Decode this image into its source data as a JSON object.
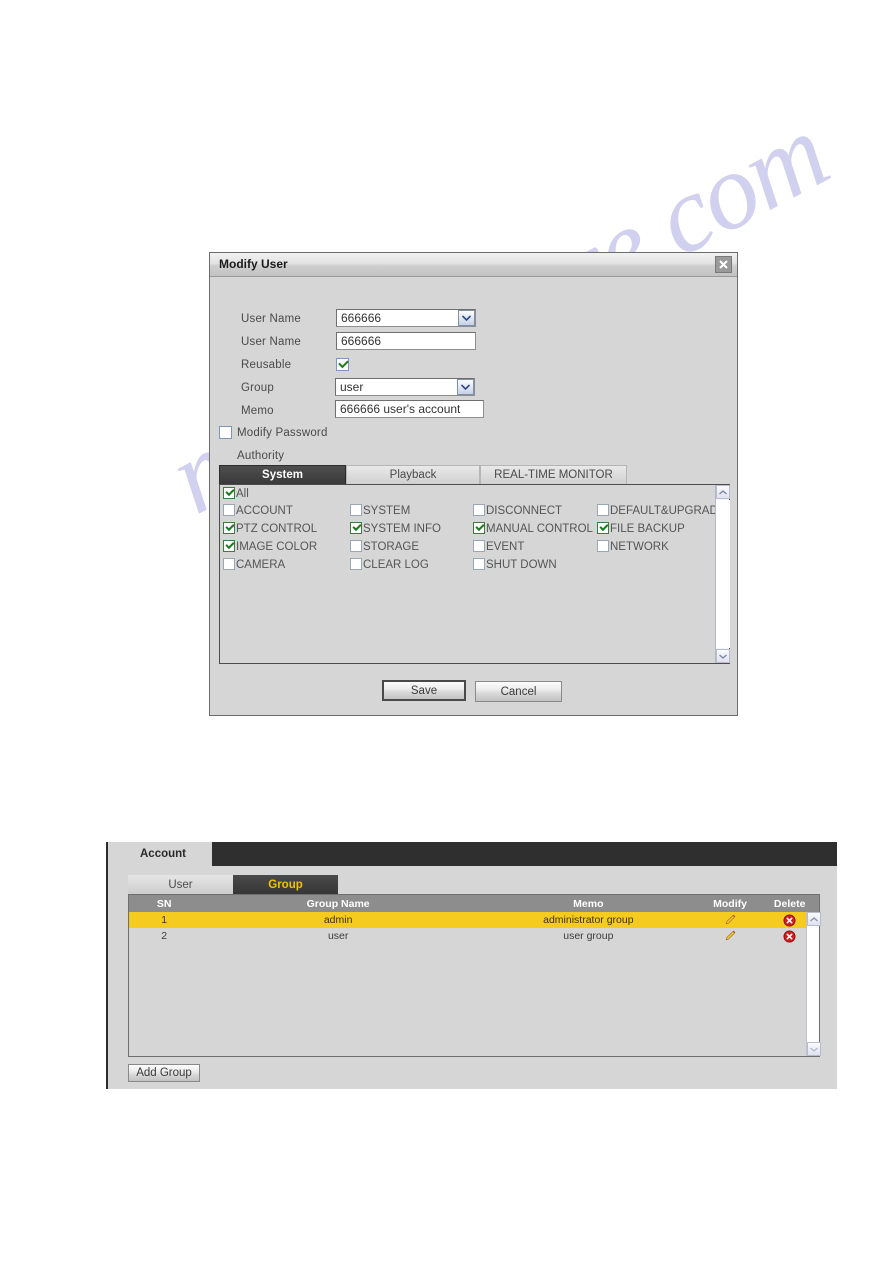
{
  "watermark": {
    "text": "manualshive.com"
  },
  "dialog": {
    "title": "Modify User",
    "close_icon": "close-icon",
    "fields": {
      "user_select_label": "User Name",
      "user_select_value": "666666",
      "user_name_label": "User Name",
      "user_name_value": "666666",
      "reusable_label": "Reusable",
      "reusable_checked": true,
      "group_label": "Group",
      "group_value": "user",
      "memo_label": "Memo",
      "memo_value": "666666 user's account",
      "modify_password_label": "Modify Password",
      "modify_password_checked": false,
      "authority_label": "Authority"
    },
    "authority_tabs": [
      {
        "label": "System",
        "active": true
      },
      {
        "label": "Playback",
        "active": false
      },
      {
        "label": "REAL-TIME MONITOR",
        "active": false
      }
    ],
    "permissions": {
      "all_label": "All",
      "all_checked": true,
      "items": [
        {
          "label": "ACCOUNT",
          "checked": false,
          "col": 0,
          "row": 0
        },
        {
          "label": "SYSTEM",
          "checked": false,
          "col": 1,
          "row": 0
        },
        {
          "label": "DISCONNECT",
          "checked": false,
          "col": 2,
          "row": 0
        },
        {
          "label": "DEFAULT&UPGRADE",
          "checked": false,
          "col": 3,
          "row": 0
        },
        {
          "label": "PTZ CONTROL",
          "checked": true,
          "col": 0,
          "row": 1
        },
        {
          "label": "SYSTEM INFO",
          "checked": true,
          "col": 1,
          "row": 1
        },
        {
          "label": "MANUAL CONTROL",
          "checked": true,
          "col": 2,
          "row": 1
        },
        {
          "label": "FILE BACKUP",
          "checked": true,
          "col": 3,
          "row": 1
        },
        {
          "label": "IMAGE COLOR",
          "checked": true,
          "col": 0,
          "row": 2
        },
        {
          "label": "STORAGE",
          "checked": false,
          "col": 1,
          "row": 2
        },
        {
          "label": "EVENT",
          "checked": false,
          "col": 2,
          "row": 2
        },
        {
          "label": "NETWORK",
          "checked": false,
          "col": 3,
          "row": 2
        },
        {
          "label": "CAMERA",
          "checked": false,
          "col": 0,
          "row": 3
        },
        {
          "label": "CLEAR LOG",
          "checked": false,
          "col": 1,
          "row": 3
        },
        {
          "label": "SHUT DOWN",
          "checked": false,
          "col": 2,
          "row": 3
        }
      ]
    },
    "buttons": {
      "save": "Save",
      "cancel": "Cancel"
    },
    "scrollbar": {
      "up_icon": "chevron-up-icon",
      "down_icon": "chevron-down-icon"
    }
  },
  "account_panel": {
    "tab_title": "Account",
    "sub_tabs": [
      {
        "label": "User",
        "active": false
      },
      {
        "label": "Group",
        "active": true
      }
    ],
    "table": {
      "columns": [
        "SN",
        "Group Name",
        "Memo",
        "Modify",
        "Delete"
      ],
      "rows": [
        {
          "sn": "1",
          "group_name": "admin",
          "memo": "administrator group",
          "selected": true
        },
        {
          "sn": "2",
          "group_name": "user",
          "memo": "user group",
          "selected": false
        }
      ],
      "modify_icon": "pencil-icon",
      "delete_icon": "delete-circle-icon"
    },
    "add_group_button": "Add Group",
    "scrollbar": {
      "up_icon": "chevron-up-icon",
      "down_icon": "chevron-down-icon"
    }
  },
  "colors": {
    "selected_row": "#f5cb1f",
    "active_tab_bg": "#3a3a3a",
    "active_subtab_text": "#f2c200",
    "panel_bg": "#d6d6d6",
    "header_bg": "#8d8d8d",
    "delete_red": "#cc1f1f",
    "check_green": "#1e7a1e",
    "watermark": "#c9c8ec"
  }
}
